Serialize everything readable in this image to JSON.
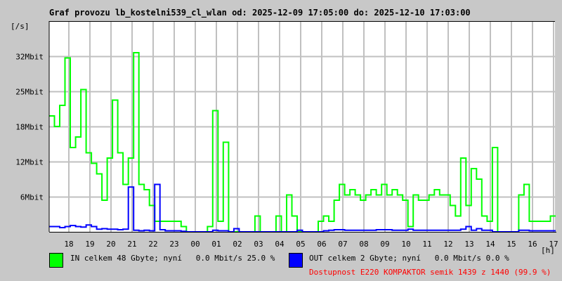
{
  "chart_data": {
    "type": "line",
    "title": "Graf provozu lb_kostelni539_cl_wlan od: 2025-12-09 17:05:00 do: 2025-12-10 17:03:00",
    "ylabel": "[/s]",
    "xlabel": "[h]",
    "ylim_mbit": [
      0,
      40
    ],
    "y_ticks": [
      {
        "value": 6.67,
        "label": "6Mbit"
      },
      {
        "value": 13.33,
        "label": "12Mbit"
      },
      {
        "value": 20,
        "label": "18Mbit"
      },
      {
        "value": 26.67,
        "label": "25Mbit"
      },
      {
        "value": 33.33,
        "label": "32Mbit"
      }
    ],
    "x_ticks": [
      "18",
      "19",
      "20",
      "21",
      "22",
      "23",
      "00",
      "01",
      "02",
      "03",
      "04",
      "05",
      "06",
      "07",
      "08",
      "09",
      "10",
      "11",
      "12",
      "13",
      "14",
      "15",
      "16",
      "17"
    ],
    "x_start_hours": 17.083,
    "x_end_hours": 41.05,
    "sample_step_minutes": 15,
    "grid": true,
    "series": [
      {
        "name": "IN",
        "color": "#00ff00",
        "unit": "Mbit/s",
        "values": [
          22,
          20,
          24,
          33,
          16,
          18,
          27,
          15,
          13,
          11,
          6,
          14,
          25,
          15,
          9,
          14,
          34,
          9,
          8,
          5,
          2,
          2,
          2,
          2,
          2,
          1,
          0,
          0,
          0,
          0,
          1,
          23,
          2,
          17,
          0,
          0,
          0,
          0,
          0,
          3,
          0,
          0,
          0,
          3,
          0,
          7,
          3,
          0,
          0,
          0,
          0,
          2,
          3,
          2,
          6,
          9,
          7,
          8,
          7,
          6,
          7,
          8,
          7,
          9,
          7,
          8,
          7,
          6,
          1,
          7,
          6,
          6,
          7,
          8,
          7,
          7,
          5,
          3,
          14,
          5,
          12,
          10,
          3,
          2,
          16,
          0,
          0,
          0,
          0,
          7,
          9,
          2,
          2,
          2,
          2,
          3,
          3
        ]
      },
      {
        "name": "OUT",
        "color": "#0000ff",
        "unit": "Mbit/s",
        "values": [
          1,
          1,
          0.8,
          1,
          1.2,
          1,
          0.9,
          1.3,
          1,
          0.5,
          0.6,
          0.5,
          0.5,
          0.4,
          0.5,
          8.5,
          0.3,
          0.2,
          0.3,
          0.2,
          9,
          0.4,
          0.2,
          0.2,
          0.2,
          0.1,
          0,
          0,
          0,
          0,
          0,
          0.3,
          0.2,
          0.2,
          0,
          0.6,
          0,
          0,
          0,
          0,
          0,
          0,
          0,
          0,
          0,
          0,
          0,
          0.3,
          0,
          0,
          0,
          0,
          0.2,
          0.3,
          0.4,
          0.4,
          0.3,
          0.3,
          0.3,
          0.3,
          0.3,
          0.3,
          0.4,
          0.4,
          0.4,
          0.3,
          0.3,
          0.3,
          0.5,
          0.3,
          0.3,
          0.3,
          0.3,
          0.3,
          0.3,
          0.3,
          0.3,
          0.3,
          0.5,
          1,
          0.3,
          0.6,
          0.3,
          0.3,
          0,
          0,
          0,
          0,
          0,
          0.3,
          0.3,
          0.2,
          0.2,
          0.2,
          0.2,
          0.2,
          0.2
        ]
      }
    ]
  },
  "legend": {
    "in_text": "IN celkem 48 Gbyte; nyní   0.0 Mbit/s 25.0 %",
    "out_text": "OUT celkem 2 Gbyte; nyní   0.0 Mbit/s 0.0 %",
    "availability": "Dostupnost E220 KOMPAKTOR semik 1439 z 1440 (99.9 %)",
    "availability_color": "#ff0000"
  }
}
